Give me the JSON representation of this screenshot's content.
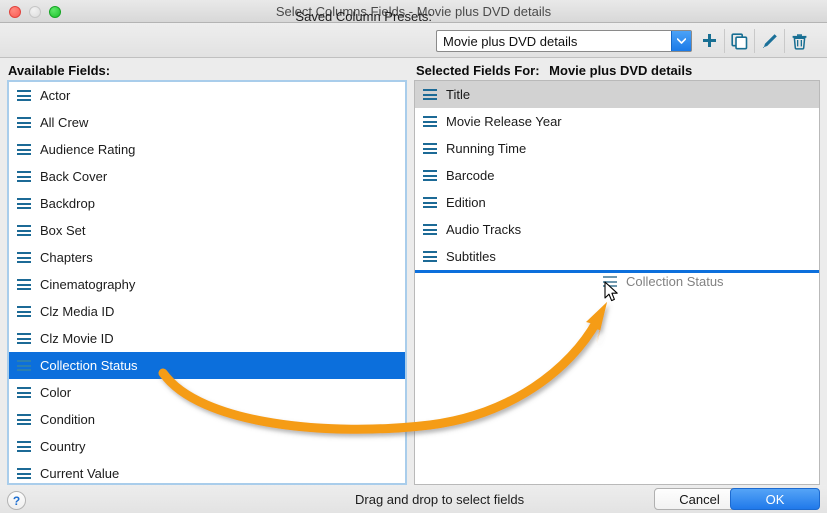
{
  "window": {
    "title": "Select Columns Fields - Movie plus DVD details",
    "traffic_lights": {
      "close": "close-button",
      "minimize": "minimize-button",
      "maximize": "maximize-button"
    }
  },
  "toolbar": {
    "presets_label": "Saved Column Presets:",
    "preset_value": "Movie plus DVD details",
    "dropdown_icon": "chevron-down-icon",
    "buttons": [
      {
        "name": "add-preset-button",
        "icon": "plus-icon"
      },
      {
        "name": "duplicate-preset-button",
        "icon": "copy-icon"
      },
      {
        "name": "edit-preset-button",
        "icon": "pencil-icon"
      },
      {
        "name": "delete-preset-button",
        "icon": "trash-icon"
      }
    ]
  },
  "available_panel": {
    "label": "Available Fields:",
    "items": [
      {
        "label": "Actor",
        "selected": false
      },
      {
        "label": "All Crew",
        "selected": false
      },
      {
        "label": "Audience Rating",
        "selected": false
      },
      {
        "label": "Back Cover",
        "selected": false
      },
      {
        "label": "Backdrop",
        "selected": false
      },
      {
        "label": "Box Set",
        "selected": false
      },
      {
        "label": "Chapters",
        "selected": false
      },
      {
        "label": "Cinematography",
        "selected": false
      },
      {
        "label": "Clz Media ID",
        "selected": false
      },
      {
        "label": "Clz Movie ID",
        "selected": false
      },
      {
        "label": "Collection Status",
        "selected": true
      },
      {
        "label": "Color",
        "selected": false
      },
      {
        "label": "Condition",
        "selected": false
      },
      {
        "label": "Country",
        "selected": false
      },
      {
        "label": "Current Value",
        "selected": false
      }
    ]
  },
  "selected_panel": {
    "label_prefix": "Selected Fields For:",
    "label_value": "Movie plus DVD details",
    "items": [
      {
        "label": "Title",
        "highlighted": true
      },
      {
        "label": "Movie Release Year",
        "highlighted": false
      },
      {
        "label": "Running Time",
        "highlighted": false
      },
      {
        "label": "Barcode",
        "highlighted": false
      },
      {
        "label": "Edition",
        "highlighted": false
      },
      {
        "label": "Audio Tracks",
        "highlighted": false
      },
      {
        "label": "Subtitles",
        "highlighted": false
      }
    ],
    "drag_ghost_label": "Collection Status"
  },
  "footer": {
    "help_label": "?",
    "hint": "Drag and drop to select fields",
    "cancel_label": "Cancel",
    "ok_label": "OK"
  },
  "colors": {
    "selection_blue": "#0c6fdc",
    "inactive_selection_gray": "#d2d2d2",
    "grip_teal": "#1c6a96",
    "accent_orange": "#f59c13",
    "ok_button_blue": "#2079ea",
    "focus_border_blue": "#a9cdeb"
  },
  "annotation": {
    "arrow_color": "#f59c13",
    "arrow_description": "curved arrow from selected field to drop target"
  }
}
